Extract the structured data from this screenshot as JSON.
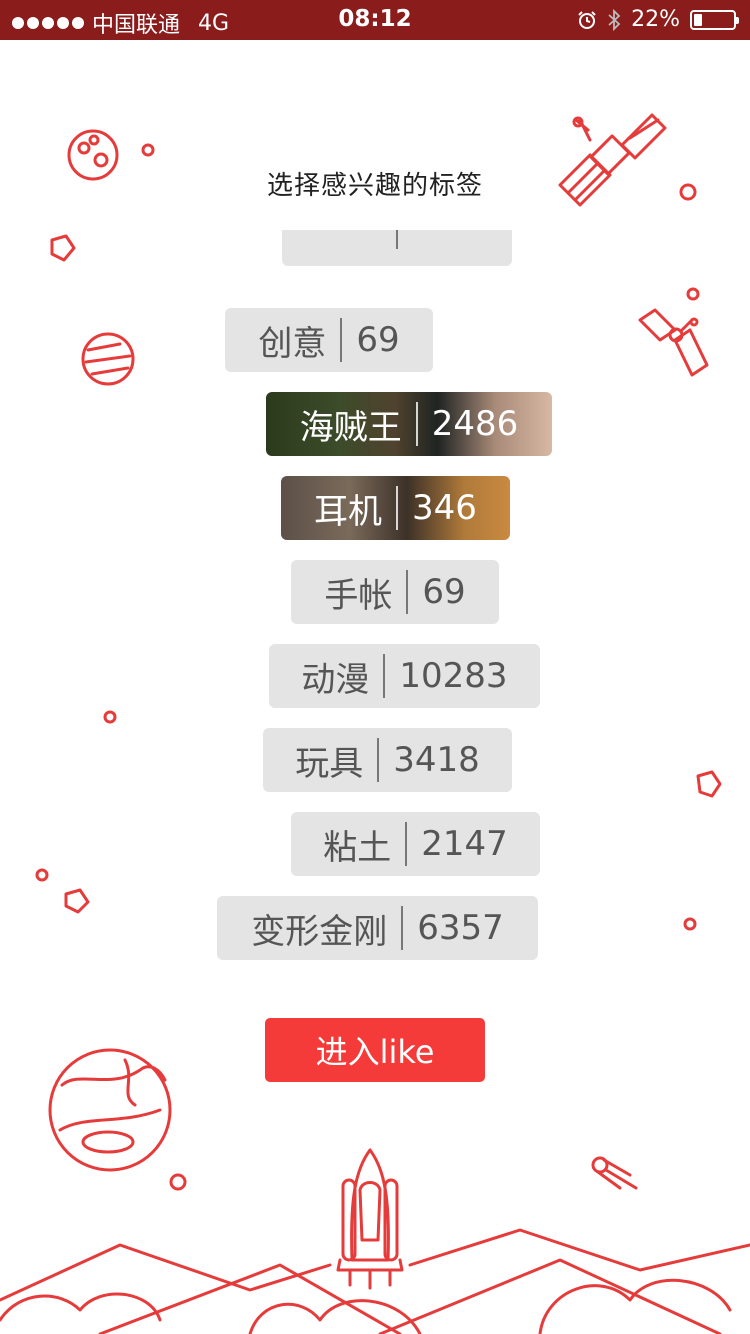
{
  "status_bar": {
    "carrier": "中国联通",
    "network": "4G",
    "time": "08:12",
    "battery_percent": "22%",
    "battery_level": 0.22
  },
  "title": "选择感兴趣的标签",
  "tags": [
    {
      "label": "创意",
      "count": "69",
      "style": "plain"
    },
    {
      "label": "海贼王",
      "count": "2486",
      "style": "photo"
    },
    {
      "label": "耳机",
      "count": "346",
      "style": "photo"
    },
    {
      "label": "手帐",
      "count": "69",
      "style": "plain"
    },
    {
      "label": "动漫",
      "count": "10283",
      "style": "plain"
    },
    {
      "label": "玩具",
      "count": "3418",
      "style": "plain"
    },
    {
      "label": "粘土",
      "count": "2147",
      "style": "plain"
    },
    {
      "label": "变形金刚",
      "count": "6357",
      "style": "plain"
    }
  ],
  "enter_button": {
    "label": "进入like"
  },
  "colors": {
    "status_bar": "#8b1c1c",
    "accent": "#f53a3a",
    "illustration": "#e63b3b",
    "tag_bg": "#e4e4e4"
  },
  "icons": [
    "alarm-icon",
    "bluetooth-icon",
    "battery-icon",
    "planet-icon",
    "satellite-icon",
    "rocket-icon",
    "comet-icon",
    "asteroid-icon"
  ]
}
